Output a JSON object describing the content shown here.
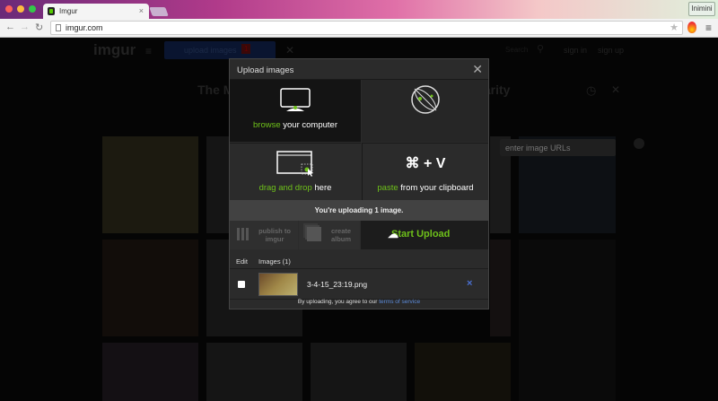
{
  "browser": {
    "tab_title": "Imgur",
    "url": "imgur.com",
    "profile": "Inimini"
  },
  "site": {
    "logo": "imgur",
    "upload_label": "upload images",
    "upload_count": "1",
    "search": "Search",
    "sign_in": "sign in",
    "sign_up": "sign up",
    "heading_left": "The M",
    "heading_right": "larity"
  },
  "modal": {
    "title": "Upload images",
    "browse": {
      "accent": "browse",
      "rest": " your computer"
    },
    "url_placeholder": "enter image URLs",
    "drag": {
      "accent": "drag and drop",
      "rest": " here"
    },
    "paste_shortcut": "⌘ + V",
    "paste": {
      "accent": "paste",
      "rest": " from your clipboard"
    },
    "status": "You're uploading 1 image.",
    "publish": "publish to imgur",
    "create_album": "create album",
    "start_upload": "Start Upload",
    "list_headers": {
      "edit": "Edit",
      "images": "Images (1)"
    },
    "files": [
      {
        "name": "3-4-15_23:19.png"
      }
    ],
    "terms_prefix": "By uploading, you agree to our ",
    "terms_link": "terms of service"
  },
  "colors": {
    "accent": "#6ec01a",
    "link": "#5b8ad8"
  }
}
